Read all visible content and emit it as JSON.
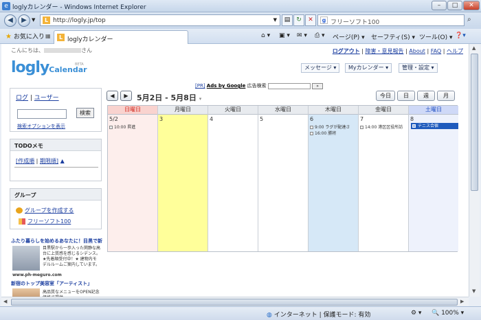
{
  "window": {
    "title": "loglyカレンダー - Windows Internet Explorer",
    "minimize": "–",
    "maximize": "□",
    "close": "✕"
  },
  "address_bar": {
    "url": "http://logly.jp/top",
    "search_text": "フリーソフト100",
    "back_icon": "back-arrow-icon",
    "forward_icon": "forward-arrow-icon"
  },
  "tab_bar": {
    "favorites_label": "お気に入り",
    "tab_label": "loglyカレンダー",
    "page_menu": "ページ(P)",
    "safety_menu": "セーフティ(S)",
    "tools_menu": "ツール(O)"
  },
  "header": {
    "greeting_prefix": "こんにちは、",
    "greeting_suffix": "さん",
    "links": [
      "ログアウト",
      "障害・意見報告",
      "About",
      "FAQ",
      "ヘルプ"
    ],
    "logo_main": "logly",
    "logo_sub": "Calendar",
    "logo_beta": "BETA",
    "menu": [
      "メッセージ",
      "Myカレンダー",
      "管理・設定"
    ]
  },
  "ad_row": {
    "pr": "[PR]",
    "ads_by_google": "Ads by Google",
    "ad_search_label": "広告検索"
  },
  "sidebar": {
    "login_links": [
      "ログ",
      "ユーザー"
    ],
    "search_button": "検索",
    "search_options": "検索オプションを表示",
    "todo_title": "TODOメモ",
    "todo_links": [
      "[作成順",
      "期限順]",
      "▲"
    ],
    "group_title": "グループ",
    "group_create": "グループを作成する",
    "group_item": "フリーソフト100"
  },
  "ads": [
    {
      "title": "ふたり暮らしを始めるあなたに！目黒で新",
      "text": "目黒駅から一歩入った閑静な高台に上質感を感じるシデンス。★先着順受付中！★ 建物内モデルルームご案内しています。",
      "url": "www.ph-meguro.com"
    },
    {
      "title": "新宿のトップ美容室「アーティスト」",
      "text": "高品質なメニューをOPEN記念価格で提供",
      "url": ""
    }
  ],
  "calendar": {
    "prev_icon": "◀",
    "next_icon": "▶",
    "range": "5月2日 - 5月8日",
    "views": [
      "今日",
      "日",
      "週",
      "月"
    ],
    "days": [
      {
        "header": "日曜日",
        "date": "5/2",
        "events": [
          {
            "time": "10:00",
            "title": "昇進"
          }
        ]
      },
      {
        "header": "月曜日",
        "date": "3",
        "events": []
      },
      {
        "header": "火曜日",
        "date": "4",
        "events": []
      },
      {
        "header": "水曜日",
        "date": "5",
        "events": []
      },
      {
        "header": "木曜日",
        "date": "6",
        "events": [
          {
            "time": "9:00",
            "title": "ラグが配達さ"
          },
          {
            "time": "16:00",
            "title": "勝将"
          }
        ]
      },
      {
        "header": "金曜日",
        "date": "7",
        "events": [
          {
            "time": "14:00",
            "title": "港区区役所訪"
          }
        ]
      },
      {
        "header": "土曜日",
        "date": "8",
        "events": [
          {
            "time": "",
            "title": "テニス合宿"
          }
        ]
      }
    ],
    "colors": {
      "sunday_header": "#f9d3cf",
      "sunday_text": "#d0241b",
      "sunday_bg": "#fdeeec",
      "monday_bg": "#ffff9a",
      "thursday_bg": "#d6e8f7",
      "saturday_header": "#cfd9f7",
      "saturday_text": "#1f4fc2",
      "saturday_bg": "#eef2fc",
      "allday_event": "#1f5bbd"
    }
  },
  "status_bar": {
    "zone": "インターネット | 保護モード: 有効",
    "zoom": "100%"
  }
}
